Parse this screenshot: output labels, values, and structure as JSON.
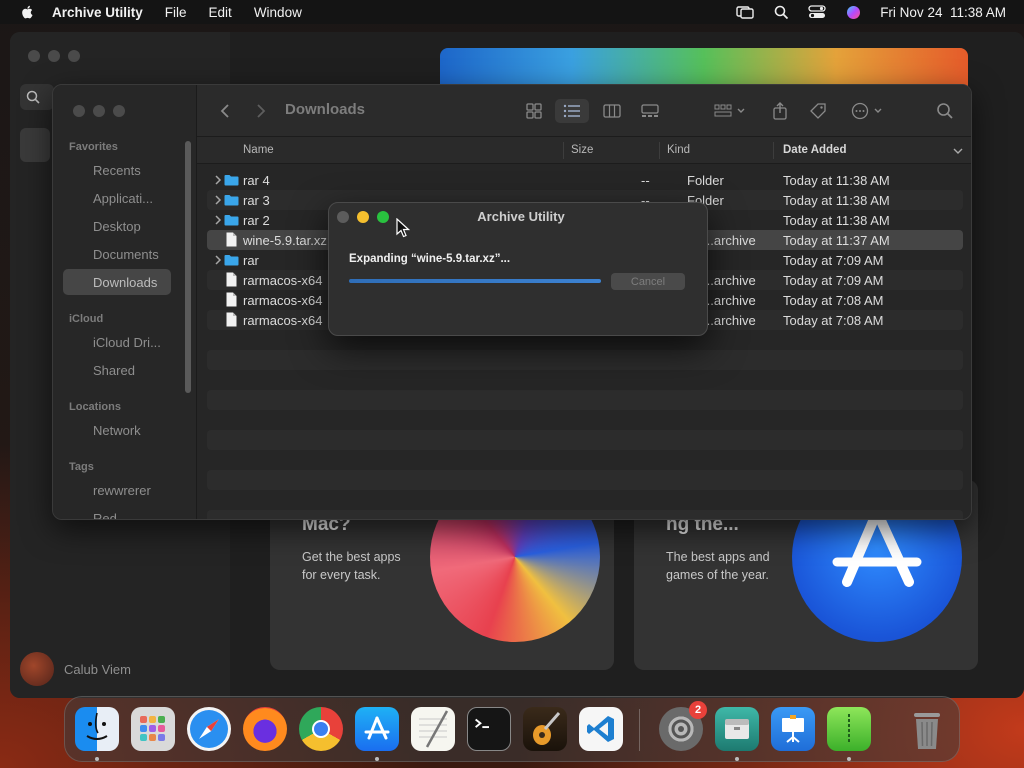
{
  "menubar": {
    "app_name": "Archive Utility",
    "menus": [
      "File",
      "Edit",
      "Window"
    ],
    "datetime": "Fri Nov 24  11:38 AM"
  },
  "background_app": {
    "user_name": "Calub Viem",
    "cards": [
      {
        "title": "Mac?",
        "text": "Get the best apps for every task."
      },
      {
        "title": "ng the...",
        "text": "The best apps and games of the year."
      }
    ]
  },
  "finder": {
    "location": "Downloads",
    "sidebar": {
      "favorites_header": "Favorites",
      "favorites": [
        "Recents",
        "Applicati...",
        "Desktop",
        "Documents",
        "Downloads"
      ],
      "selected": "Downloads",
      "icloud_header": "iCloud",
      "icloud": [
        "iCloud Dri...",
        "Shared"
      ],
      "locations_header": "Locations",
      "locations": [
        "Network"
      ],
      "tags_header": "Tags",
      "tags": [
        "rewwrerer",
        "Red"
      ]
    },
    "columns": {
      "name": "Name",
      "size": "Size",
      "kind": "Kind",
      "date": "Date Added"
    },
    "rows": [
      {
        "name": "rar 4",
        "size": "--",
        "kind": "Folder",
        "date": "Today at 11:38 AM",
        "type": "folder"
      },
      {
        "name": "rar 3",
        "size": "--",
        "kind": "Folder",
        "date": "Today at 11:38 AM",
        "type": "folder"
      },
      {
        "name": "rar 2",
        "size": "",
        "kind": "",
        "date": "Today at 11:38 AM",
        "type": "folder"
      },
      {
        "name": "wine-5.9.tar.xz",
        "size": "",
        "kind": "...archive",
        "date": "Today at 11:37 AM",
        "type": "file"
      },
      {
        "name": "rar",
        "size": "",
        "kind": "",
        "date": "Today at 7:09 AM",
        "type": "folder"
      },
      {
        "name": "rarmacos-x64",
        "size": "",
        "kind": "...archive",
        "date": "Today at 7:09 AM",
        "type": "file"
      },
      {
        "name": "rarmacos-x64",
        "size": "",
        "kind": "...archive",
        "date": "Today at 7:08 AM",
        "type": "file"
      },
      {
        "name": "rarmacos-x64",
        "size": "",
        "kind": "...archive",
        "date": "Today at 7:08 AM",
        "type": "file"
      }
    ]
  },
  "dialog": {
    "title": "Archive Utility",
    "message": "Expanding “wine-5.9.tar.xz”...",
    "cancel_label": "Cancel",
    "progress": 1.0
  },
  "dock": {
    "settings_badge": "2",
    "apps": [
      "Finder",
      "Launchpad",
      "Safari",
      "Firefox",
      "Chrome",
      "App Store",
      "TextEdit",
      "Terminal",
      "GarageBand",
      "VS Code",
      "System Settings",
      "Archive Utility",
      "Keynote",
      "Archive"
    ]
  },
  "colors": {
    "accent_blue": "#2f6eb8",
    "close": "#5c5c5c",
    "minimize": "#f5bf2e",
    "zoom": "#29c23f",
    "badge": "#e8413a"
  }
}
